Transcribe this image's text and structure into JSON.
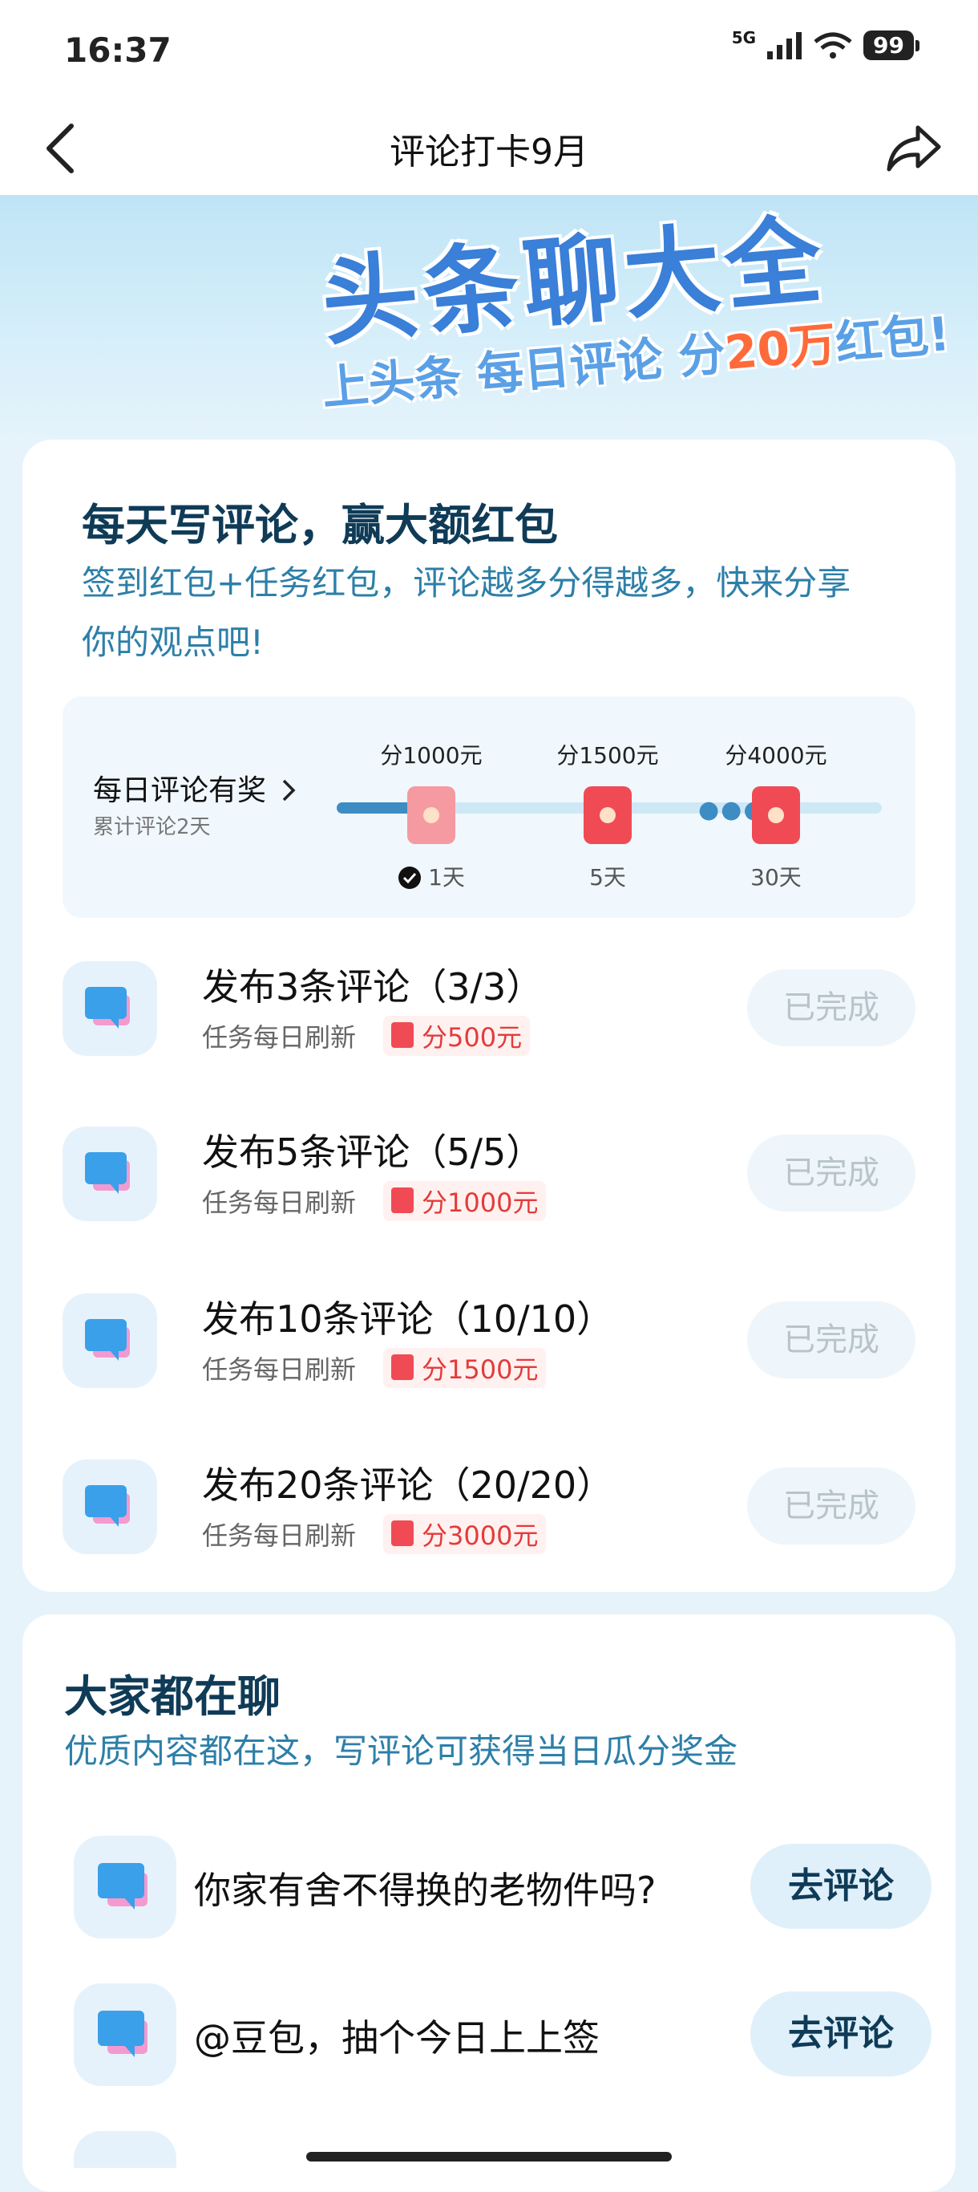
{
  "status": {
    "time": "16:37",
    "network": "5G",
    "battery": "99"
  },
  "nav": {
    "title": "评论打卡9月"
  },
  "banner": {
    "title": "头条聊大全",
    "sub_prefix": "上头条 每日评论 分",
    "sub_highlight": "20万",
    "sub_suffix": "红包!"
  },
  "intro": {
    "title": "每天写评论，赢大额红包",
    "desc_line1": "签到红包+任务红包，评论越多分得越多，快来分享",
    "desc_line2": "你的观点吧!"
  },
  "daily": {
    "title": "每日评论有奖",
    "subtitle": "累计评论2天",
    "progress_fraction": 0.18,
    "milestones": [
      {
        "reward": "分1000元",
        "day": "1天",
        "done": true
      },
      {
        "reward": "分1500元",
        "day": "5天",
        "done": false
      },
      {
        "reward": "分4000元",
        "day": "30天",
        "done": false
      }
    ]
  },
  "tasks": [
    {
      "title": "发布3条评论（3/3）",
      "sub": "任务每日刷新",
      "reward": "分500元",
      "button": "已完成"
    },
    {
      "title": "发布5条评论（5/5）",
      "sub": "任务每日刷新",
      "reward": "分1000元",
      "button": "已完成"
    },
    {
      "title": "发布10条评论（10/10）",
      "sub": "任务每日刷新",
      "reward": "分1500元",
      "button": "已完成"
    },
    {
      "title": "发布20条评论（20/20）",
      "sub": "任务每日刷新",
      "reward": "分3000元",
      "button": "已完成"
    }
  ],
  "chat_section": {
    "title": "大家都在聊",
    "desc": "优质内容都在这，写评论可获得当日瓜分奖金",
    "items": [
      {
        "title": "你家有舍不得换的老物件吗?",
        "button": "去评论"
      },
      {
        "title": "@豆包，抽个今日上上签",
        "button": "去评论"
      }
    ]
  },
  "colors": {
    "accent": "#0f3b57",
    "link": "#2d7fa8",
    "red_packet": "#f04b55"
  },
  "icons": [
    "back-icon",
    "share-icon",
    "chat-bubble-icon",
    "red-packet-icon",
    "check-icon",
    "chevron-right-icon"
  ]
}
